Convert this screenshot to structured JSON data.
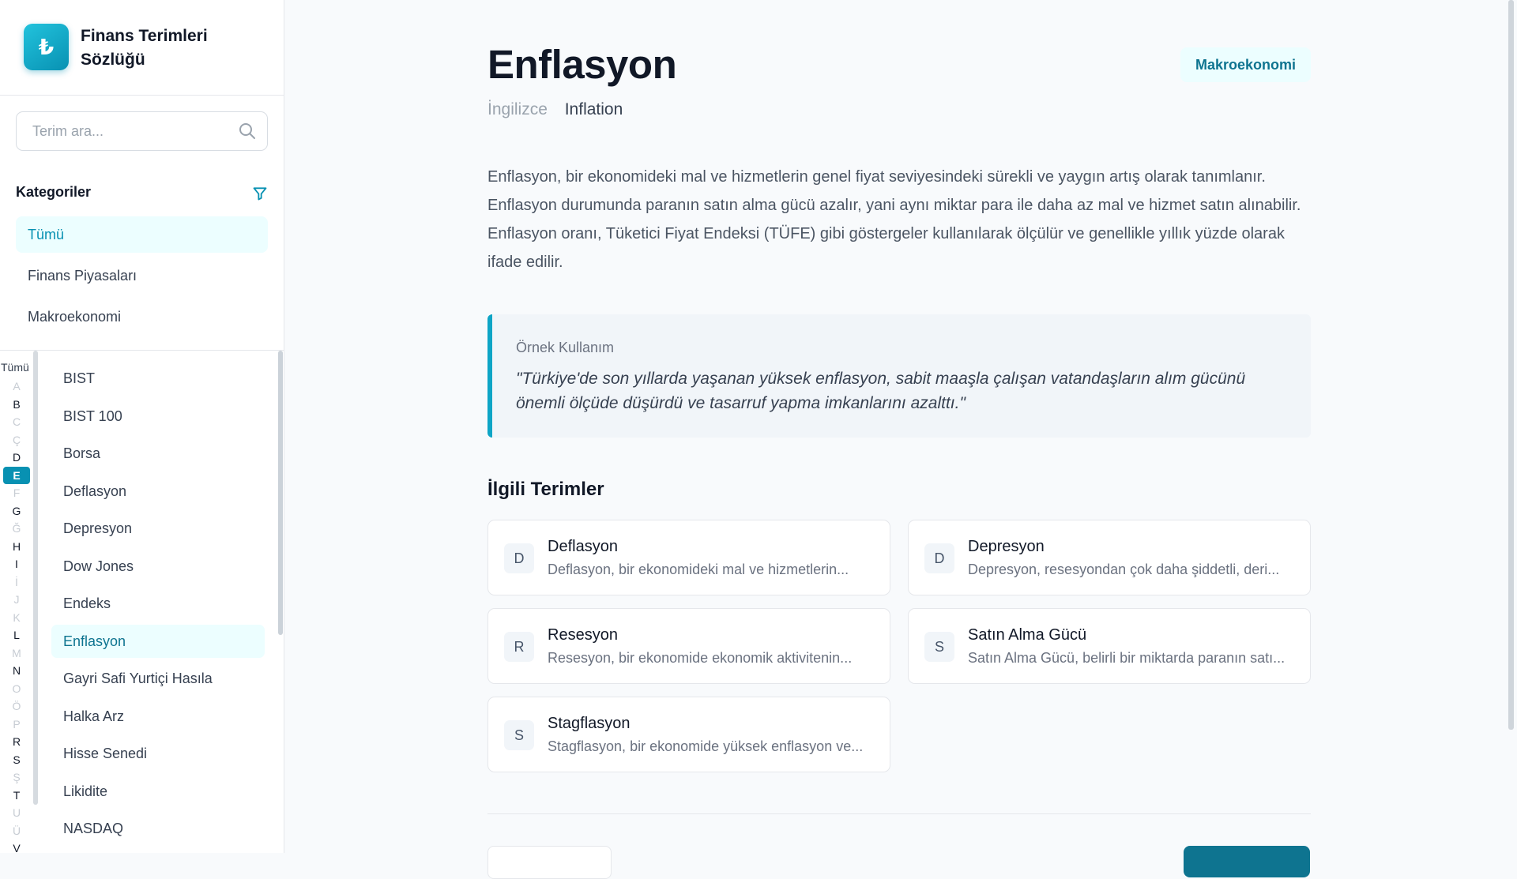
{
  "sidebar": {
    "logo_symbol": "₺",
    "title": "Finans Terimleri Sözlüğü",
    "search": {
      "placeholder": "Terim ara...",
      "value": ""
    },
    "categories_title": "Kategoriler",
    "categories": [
      {
        "label": "Tümü",
        "active": true
      },
      {
        "label": "Finans Piyasaları",
        "active": false
      },
      {
        "label": "Makroekonomi",
        "active": false
      }
    ],
    "alphabet_all": "Tümü",
    "alphabet": [
      {
        "letter": "A",
        "enabled": false
      },
      {
        "letter": "B",
        "enabled": true
      },
      {
        "letter": "C",
        "enabled": false
      },
      {
        "letter": "Ç",
        "enabled": false
      },
      {
        "letter": "D",
        "enabled": true
      },
      {
        "letter": "E",
        "enabled": true,
        "active": true
      },
      {
        "letter": "F",
        "enabled": false
      },
      {
        "letter": "G",
        "enabled": true
      },
      {
        "letter": "Ğ",
        "enabled": false
      },
      {
        "letter": "H",
        "enabled": true
      },
      {
        "letter": "I",
        "enabled": true
      },
      {
        "letter": "İ",
        "enabled": false
      },
      {
        "letter": "J",
        "enabled": false
      },
      {
        "letter": "K",
        "enabled": false
      },
      {
        "letter": "L",
        "enabled": true
      },
      {
        "letter": "M",
        "enabled": false
      },
      {
        "letter": "N",
        "enabled": true
      },
      {
        "letter": "O",
        "enabled": false
      },
      {
        "letter": "Ö",
        "enabled": false
      },
      {
        "letter": "P",
        "enabled": false
      },
      {
        "letter": "R",
        "enabled": true
      },
      {
        "letter": "S",
        "enabled": true
      },
      {
        "letter": "Ş",
        "enabled": false
      },
      {
        "letter": "T",
        "enabled": true
      },
      {
        "letter": "U",
        "enabled": false
      },
      {
        "letter": "Ü",
        "enabled": false
      },
      {
        "letter": "V",
        "enabled": true
      }
    ],
    "terms": [
      {
        "label": "BIST",
        "active": false
      },
      {
        "label": "BIST 100",
        "active": false
      },
      {
        "label": "Borsa",
        "active": false
      },
      {
        "label": "Deflasyon",
        "active": false
      },
      {
        "label": "Depresyon",
        "active": false
      },
      {
        "label": "Dow Jones",
        "active": false
      },
      {
        "label": "Endeks",
        "active": false
      },
      {
        "label": "Enflasyon",
        "active": true
      },
      {
        "label": "Gayri Safi Yurtiçi Hasıla",
        "active": false
      },
      {
        "label": "Halka Arz",
        "active": false
      },
      {
        "label": "Hisse Senedi",
        "active": false
      },
      {
        "label": "Likidite",
        "active": false
      },
      {
        "label": "NASDAQ",
        "active": false
      }
    ]
  },
  "main": {
    "title": "Enflasyon",
    "category_badge": "Makroekonomi",
    "english_label": "İngilizce",
    "english_value": "Inflation",
    "definition": "Enflasyon, bir ekonomideki mal ve hizmetlerin genel fiyat seviyesindeki sürekli ve yaygın artış olarak tanımlanır. Enflasyon durumunda paranın satın alma gücü azalır, yani aynı miktar para ile daha az mal ve hizmet satın alınabilir. Enflasyon oranı, Tüketici Fiyat Endeksi (TÜFE) gibi göstergeler kullanılarak ölçülür ve genellikle yıllık yüzde olarak ifade edilir.",
    "example_label": "Örnek Kullanım",
    "example_text": "\"Türkiye'de son yıllarda yaşanan yüksek enflasyon, sabit maaşla çalışan vatandaşların alım gücünü önemli ölçüde düşürdü ve tasarruf yapma imkanlarını azalttı.\"",
    "related_title": "İlgili Terimler",
    "related": [
      {
        "letter": "D",
        "name": "Deflasyon",
        "desc": "Deflasyon, bir ekonomideki mal ve hizmetlerin..."
      },
      {
        "letter": "D",
        "name": "Depresyon",
        "desc": "Depresyon, resesyondan çok daha şiddetli, deri..."
      },
      {
        "letter": "R",
        "name": "Resesyon",
        "desc": "Resesyon, bir ekonomide ekonomik aktivitenin..."
      },
      {
        "letter": "S",
        "name": "Satın Alma Gücü",
        "desc": "Satın Alma Gücü, belirli bir miktarda paranın satı..."
      },
      {
        "letter": "S",
        "name": "Stagflasyon",
        "desc": "Stagflasyon, bir ekonomide yüksek enflasyon ve..."
      }
    ]
  },
  "colors": {
    "accent": "#0891b2",
    "accent_light": "#ecfeff",
    "text": "#111827",
    "muted": "#6b7280"
  }
}
